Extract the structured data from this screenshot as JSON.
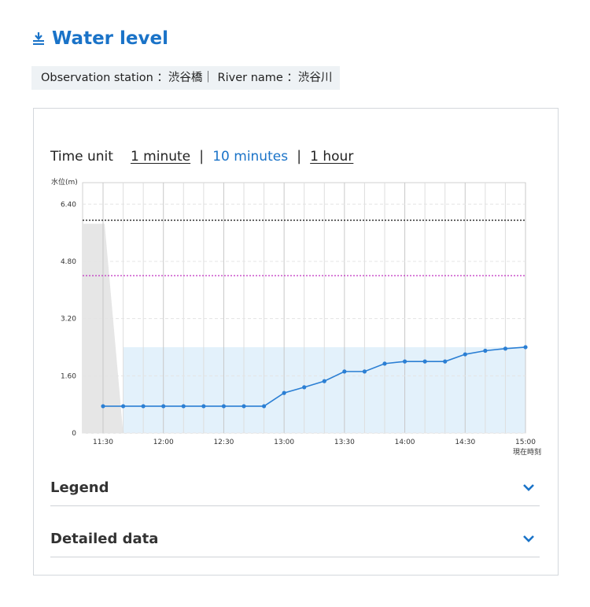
{
  "header": {
    "title": "Water level",
    "station_text": "Observation station ：渋谷橋｜ River name ：渋谷川"
  },
  "time_unit": {
    "label": "Time unit",
    "options": [
      "1 minute",
      "10 minutes",
      "1 hour"
    ],
    "selected": "10 minutes"
  },
  "accordions": {
    "legend": "Legend",
    "detailed": "Detailed data"
  },
  "colors": {
    "accent": "#1a73c8",
    "series": "#2b7fd4",
    "fill": "#e3f1fb",
    "gray_band": "#e6e6e6",
    "level_black": "#222222",
    "level_magenta": "#c030c0"
  },
  "chart_data": {
    "type": "line",
    "ylabel": "水位(m)",
    "y_ticks": [
      "0",
      "1.60",
      "3.20",
      "4.80",
      "6.40"
    ],
    "x_ticks": [
      "11:30",
      "12:00",
      "12:30",
      "13:00",
      "13:30",
      "14:00",
      "14:30",
      "15:00"
    ],
    "x_note": "現在時刻",
    "ylim": [
      0,
      7.0
    ],
    "x": [
      "11:30",
      "11:40",
      "11:50",
      "12:00",
      "12:10",
      "12:20",
      "12:30",
      "12:40",
      "12:50",
      "13:00",
      "13:10",
      "13:20",
      "13:30",
      "13:40",
      "13:50",
      "14:00",
      "14:10",
      "14:20",
      "14:30",
      "14:40",
      "14:50",
      "15:00"
    ],
    "values": [
      0.75,
      0.75,
      0.75,
      0.75,
      0.75,
      0.75,
      0.75,
      0.75,
      0.75,
      1.12,
      1.28,
      1.45,
      1.72,
      1.72,
      1.94,
      2.0,
      2.0,
      2.0,
      2.2,
      2.3,
      2.36,
      2.4
    ],
    "reference_lines": [
      5.95,
      4.4
    ],
    "grid": true
  }
}
